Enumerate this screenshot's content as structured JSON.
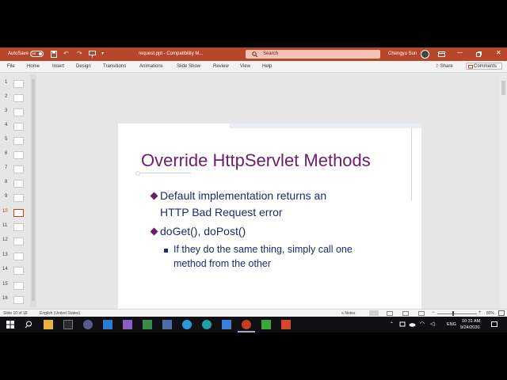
{
  "titlebar": {
    "autosave_label": "AutoSave",
    "autosave_state": "Off",
    "document_title": "request.ppt - Compatibility M...",
    "search_placeholder": "Search",
    "user_name": "Chengyu Sun"
  },
  "menubar": {
    "tabs": [
      "File",
      "Home",
      "Insert",
      "Design",
      "Transitions",
      "Animations",
      "Slide Show",
      "Review",
      "View",
      "Help"
    ],
    "share_label": "Share",
    "comments_label": "Comments"
  },
  "thumbnails": {
    "numbers": [
      "1",
      "2",
      "3",
      "4",
      "5",
      "6",
      "7",
      "8",
      "9",
      "10",
      "11",
      "12",
      "13",
      "14",
      "15",
      "16"
    ],
    "selected": "10"
  },
  "slide": {
    "title": "Override HttpServlet Methods",
    "bullet1_line1": "Default implementation returns an",
    "bullet1_line2": "HTTP Bad Request error",
    "bullet2": "doGet(), doPost()",
    "sub_line1": "If they do the same thing, simply call one",
    "sub_line2": "method from the other"
  },
  "statusbar": {
    "slide_info": "Slide 10 of 18",
    "language": "English (United States)",
    "notes_label": "Notes",
    "zoom": "80%"
  },
  "taskbar": {
    "lang": "ENG",
    "time": "10:31 AM",
    "date": "9/24/2020"
  },
  "colors": {
    "accent": "#b7472a",
    "title_color": "#6b1e6b",
    "body_color": "#1f2a6b"
  }
}
